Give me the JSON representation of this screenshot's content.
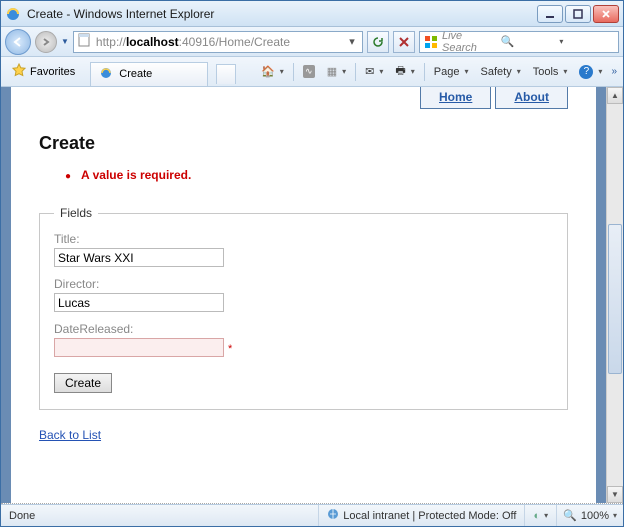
{
  "window": {
    "title": "Create - Windows Internet Explorer"
  },
  "nav": {
    "url_prefix": "http://",
    "url_host": "localhost",
    "url_rest": ":40916/Home/Create",
    "search_placeholder": "Live Search"
  },
  "favorites": {
    "label": "Favorites",
    "tab_title": "Create"
  },
  "toolbar": {
    "page": "Page",
    "safety": "Safety",
    "tools": "Tools"
  },
  "pageNav": {
    "home": "Home",
    "about": "About"
  },
  "content": {
    "heading": "Create",
    "error": "A value is required.",
    "legend": "Fields",
    "title_label": "Title:",
    "title_value": "Star Wars XXI",
    "director_label": "Director:",
    "director_value": "Lucas",
    "date_label": "DateReleased:",
    "date_value": "",
    "required_mark": "*",
    "submit": "Create",
    "back": "Back to List"
  },
  "status": {
    "done": "Done",
    "zone": "Local intranet | Protected Mode: Off",
    "zoom": "100%"
  }
}
